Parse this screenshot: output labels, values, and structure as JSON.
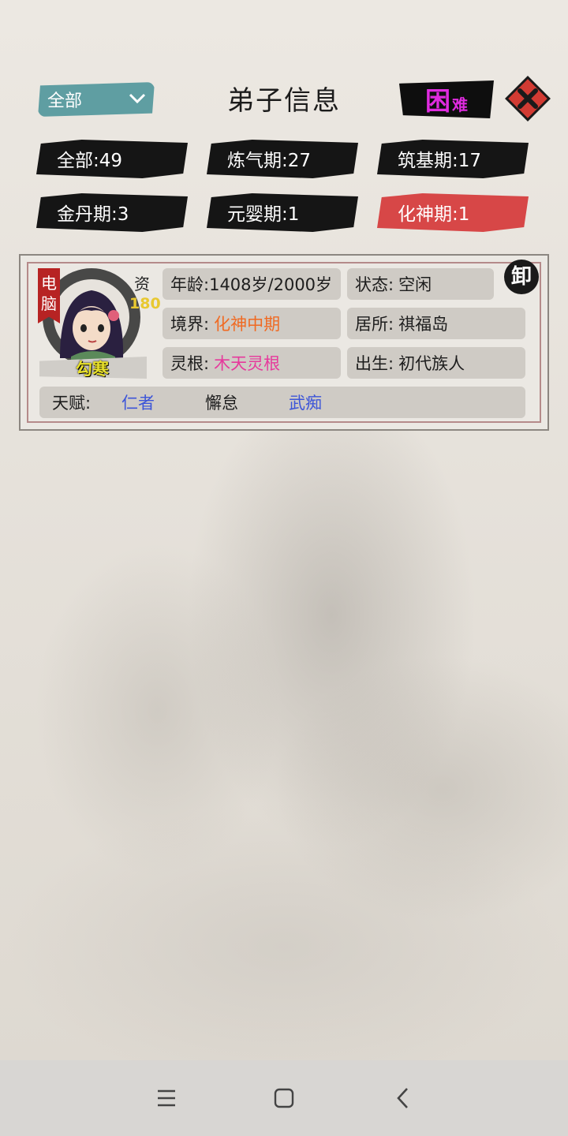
{
  "header": {
    "filter_selected": "全部",
    "title": "弟子信息",
    "difficulty_big": "困",
    "difficulty_small": "难"
  },
  "filters": [
    {
      "label": "全部",
      "count": "49"
    },
    {
      "label": "炼气期",
      "count": "27"
    },
    {
      "label": "筑基期",
      "count": "17"
    },
    {
      "label": "金丹期",
      "count": "3"
    },
    {
      "label": "元婴期",
      "count": "1"
    },
    {
      "label": "化神期",
      "count": "1"
    }
  ],
  "filters_text": [
    "全部:49",
    "炼气期:27",
    "筑基期:17",
    "金丹期:3",
    "元婴期:1",
    "化神期:1"
  ],
  "disciple": {
    "controller_tag": "电脑",
    "aptitude_label": "资",
    "aptitude_value": "180",
    "name": "勾寒",
    "age_label": "年龄:",
    "age_value": "1408岁/2000岁",
    "status_label": "状态:",
    "status_value": "空闲",
    "realm_label": "境界:",
    "realm_value": "化神中期",
    "residence_label": "居所:",
    "residence_value": "祺福岛",
    "root_label": "灵根:",
    "root_value": "木天灵根",
    "birth_label": "出生:",
    "birth_value": "初代族人",
    "talent_label": "天赋:",
    "talents": [
      "仁者",
      "懈怠",
      "武痴"
    ],
    "seal_char": "卸"
  },
  "colors": {
    "realm": "#f06a22",
    "root": "#e6399c",
    "talent_blue": "#3d55d8",
    "active_chip": "#d74747",
    "difficulty": "#e02be0"
  },
  "navbar": {
    "icons": [
      "menu-icon",
      "home-icon",
      "back-icon"
    ]
  }
}
